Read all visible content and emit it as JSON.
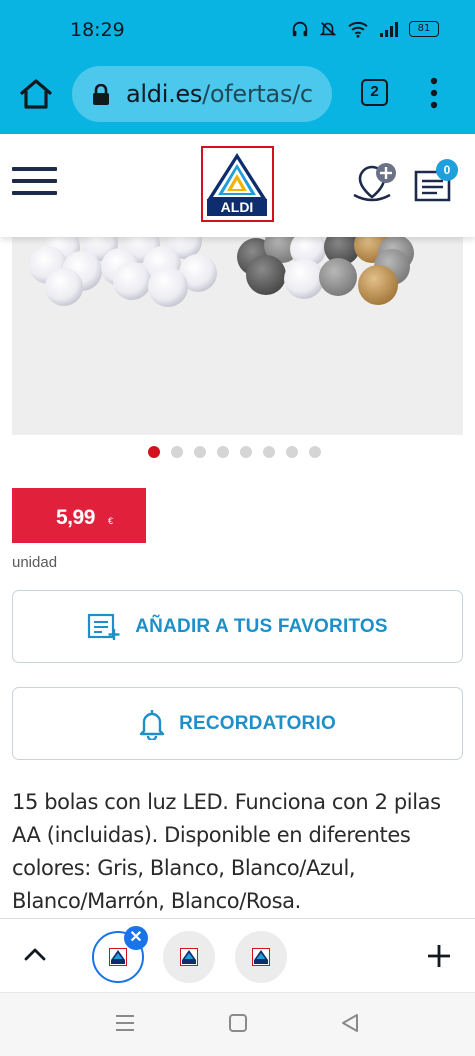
{
  "status_bar": {
    "time": "18:29",
    "battery": "81"
  },
  "browser": {
    "url_domain": "aldi.es",
    "url_path": "/ofertas/c",
    "tab_count": "2",
    "accent_color": "#0ab4e2"
  },
  "header": {
    "logo_text": "ALDI",
    "cart_count": "0"
  },
  "carousel": {
    "total_slides": 8,
    "active_slide": 1
  },
  "product": {
    "price": "5,99",
    "currency": "€",
    "unit": "unidad",
    "price_color": "#e1203c",
    "favorites_label": "AÑADIR A TUS FAVORITOS",
    "reminder_label": "RECORDATORIO",
    "description": "15 bolas con luz LED. Funciona con 2 pilas AA (incluidas). Disponible en diferentes colores: Gris, Blanco, Blanco/Azul, Blanco/Marrón, Blanco/Rosa."
  },
  "tab_strip": {
    "close_symbol": "✕",
    "tabs": [
      {
        "label": "ALDI",
        "active": true
      },
      {
        "label": "ALDI",
        "active": false
      },
      {
        "label": "ALDI",
        "active": false
      }
    ]
  }
}
